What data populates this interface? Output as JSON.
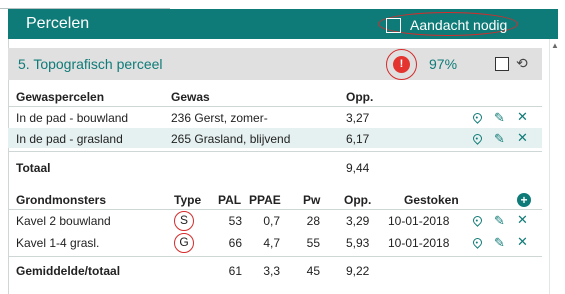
{
  "header": {
    "title": "Percelen",
    "attention_label": "Aandacht nodig"
  },
  "section": {
    "title": "5. Topografisch perceel",
    "warning_glyph": "!",
    "percentage": "97%",
    "history_icon": "history-icon"
  },
  "crops": {
    "headers": {
      "name": "Gewaspercelen",
      "crop": "Gewas",
      "area": "Opp."
    },
    "rows": [
      {
        "name": "In de pad - bouwland",
        "crop": "236 Gerst, zomer-",
        "area": "3,27"
      },
      {
        "name": "In de pad - grasland",
        "crop": "265 Grasland, blijvend",
        "area": "6,17"
      }
    ],
    "total_label": "Totaal",
    "total_area": "9,44"
  },
  "samples": {
    "headers": {
      "name": "Grondmonsters",
      "type": "Type",
      "pal": "PAL",
      "ppae": "PPAE",
      "pw": "Pw",
      "area": "Opp.",
      "date": "Gestoken"
    },
    "rows": [
      {
        "name": "Kavel 2 bouwland",
        "type": "S",
        "pal": "53",
        "ppae": "0,7",
        "pw": "28",
        "area": "3,29",
        "date": "10-01-2018"
      },
      {
        "name": "Kavel 1-4 grasl.",
        "type": "G",
        "pal": "66",
        "ppae": "4,7",
        "pw": "55",
        "area": "5,93",
        "date": "10-01-2018"
      }
    ],
    "avg_label": "Gemiddelde/totaal",
    "avg": {
      "pal": "61",
      "ppae": "3,3",
      "pw": "45",
      "area": "9,22"
    }
  },
  "icons": {
    "row_actions": [
      "map-pin-icon",
      "pencil-icon",
      "close-icon"
    ],
    "add": "plus-circle-icon"
  },
  "colors": {
    "accent": "#0f7b78",
    "highlight_row": "#e5f1f0",
    "section_bar": "#e0e0e0",
    "warning": "#e3342f",
    "annotation": "#d62b2b"
  }
}
